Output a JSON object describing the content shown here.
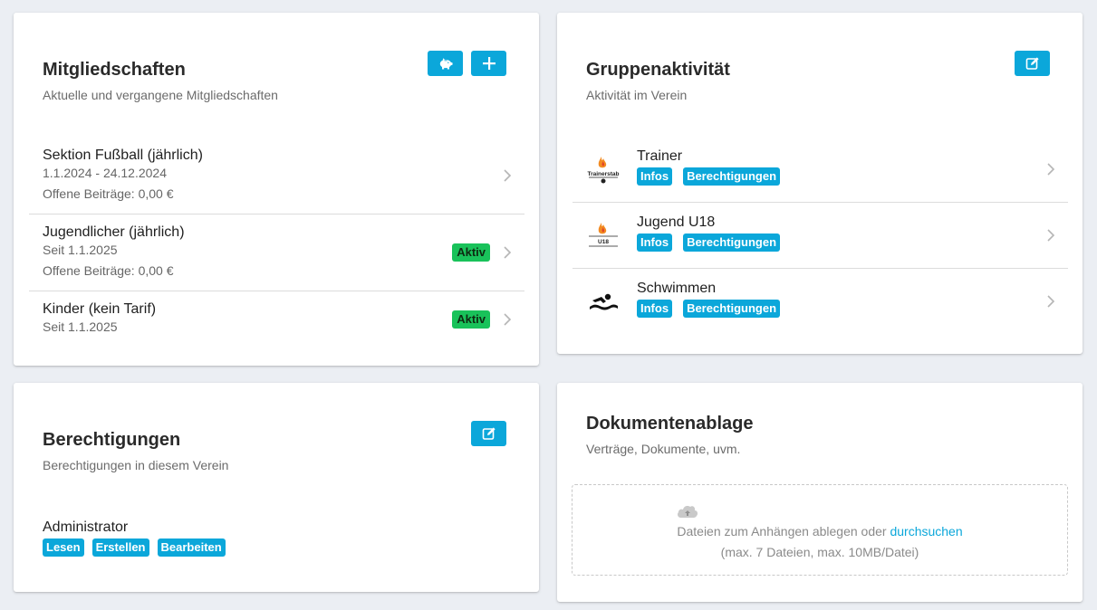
{
  "colors": {
    "accent": "#0ba7da",
    "active_badge": "#19c25a",
    "background": "#ebeef3"
  },
  "memberships": {
    "title": "Mitgliedschaften",
    "subtitle": "Aktuelle und vergangene Mitgliedschaften",
    "actions": [
      {
        "icon": "piggy-bank-icon"
      },
      {
        "icon": "plus-icon"
      }
    ],
    "items": [
      {
        "title": "Sektion Fußball (jährlich)",
        "dates": "1.1.2024 - 24.12.2024",
        "dues": "Offene Beiträge: 0,00 €",
        "badge": ""
      },
      {
        "title": "Jugendlicher (jährlich)",
        "dates": "Seit 1.1.2025",
        "dues": "Offene Beiträge: 0,00 €",
        "badge": "Aktiv"
      },
      {
        "title": "Kinder (kein Tarif)",
        "dates": "Seit 1.1.2025",
        "dues": "",
        "badge": "Aktiv"
      }
    ]
  },
  "groups": {
    "title": "Gruppenaktivität",
    "subtitle": "Aktivität im Verein",
    "action_icon": "edit-icon",
    "items": [
      {
        "title": "Trainer",
        "icon": "trainerstab-logo",
        "logo_text": "Trainerstab",
        "tags": [
          "Infos",
          "Berechtigungen"
        ]
      },
      {
        "title": "Jugend U18",
        "icon": "u18-logo",
        "logo_text": "U18",
        "tags": [
          "Infos",
          "Berechtigungen"
        ]
      },
      {
        "title": "Schwimmen",
        "icon": "swimmer-icon",
        "tags": [
          "Infos",
          "Berechtigungen"
        ]
      }
    ]
  },
  "permissions": {
    "title": "Berechtigungen",
    "subtitle": "Berechtigungen in diesem Verein",
    "action_icon": "edit-icon",
    "role": "Administrator",
    "tags": [
      "Lesen",
      "Erstellen",
      "Bearbeiten"
    ]
  },
  "documents": {
    "title": "Dokumentenablage",
    "subtitle": "Verträge, Dokumente, uvm.",
    "drop_text": "Dateien zum Anhängen ablegen oder",
    "browse_link": "durchsuchen",
    "limits": "(max. 7 Dateien, max. 10MB/Datei)",
    "icon": "cloud-upload-icon"
  }
}
